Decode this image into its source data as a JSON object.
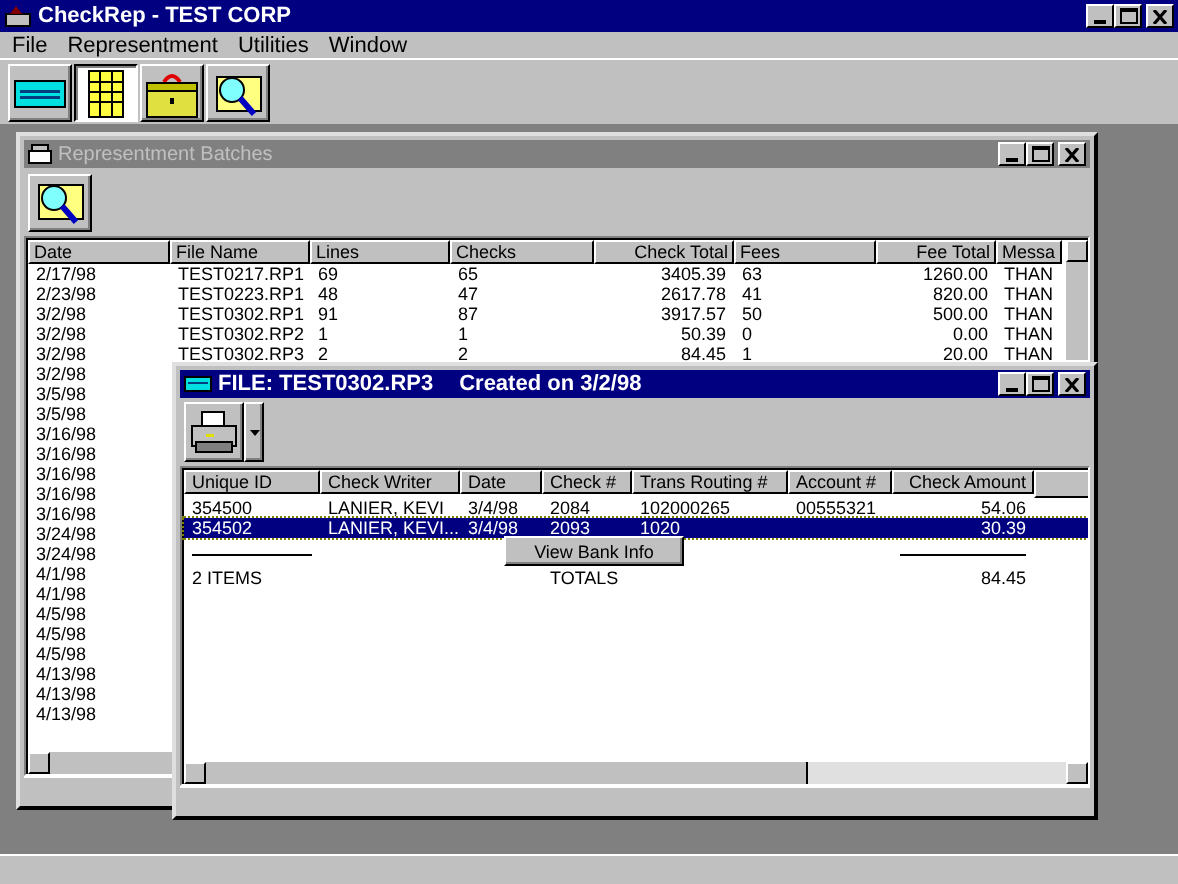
{
  "window": {
    "title": "CheckRep - TEST CORP"
  },
  "menu": [
    "File",
    "Representment",
    "Utilities",
    "Window"
  ],
  "toolbar": [
    {
      "kind": "check",
      "selected": false
    },
    {
      "kind": "ledger",
      "selected": true
    },
    {
      "kind": "cashbox",
      "selected": false
    },
    {
      "kind": "search",
      "selected": false
    }
  ],
  "batches": {
    "title": "Representment Batches",
    "columns": [
      "Date",
      "File Name",
      "Lines",
      "Checks",
      "Check Total",
      "Fees",
      "Fee Total",
      "Messa"
    ],
    "rows": [
      [
        "2/17/98",
        "TEST0217.RP1",
        "69",
        "65",
        "3405.39",
        "63",
        "1260.00",
        "THAN"
      ],
      [
        "2/23/98",
        "TEST0223.RP1",
        "48",
        "47",
        "2617.78",
        "41",
        "820.00",
        "THAN"
      ],
      [
        "3/2/98",
        "TEST0302.RP1",
        "91",
        "87",
        "3917.57",
        "50",
        "500.00",
        "THAN"
      ],
      [
        "3/2/98",
        "TEST0302.RP2",
        "1",
        "1",
        "50.39",
        "0",
        "0.00",
        "THAN"
      ],
      [
        "3/2/98",
        "TEST0302.RP3",
        "2",
        "2",
        "84.45",
        "1",
        "20.00",
        "THAN"
      ],
      [
        "3/2/98"
      ],
      [
        "3/5/98"
      ],
      [
        "3/5/98"
      ],
      [
        "3/16/98"
      ],
      [
        "3/16/98"
      ],
      [
        "3/16/98"
      ],
      [
        "3/16/98"
      ],
      [
        "3/16/98"
      ],
      [
        "3/24/98"
      ],
      [
        "3/24/98"
      ],
      [
        "4/1/98"
      ],
      [
        "4/1/98"
      ],
      [
        "4/5/98"
      ],
      [
        "4/5/98"
      ],
      [
        "4/5/98"
      ],
      [
        "4/13/98"
      ],
      [
        "4/13/98"
      ],
      [
        "4/13/98"
      ]
    ]
  },
  "file_window": {
    "title": "FILE:  TEST0302.RP3",
    "created": "Created on 3/2/98",
    "columns": [
      "Unique ID",
      "Check Writer",
      "Date",
      "Check #",
      "Trans Routing #",
      "Account #",
      "Check Amount"
    ],
    "rows": [
      {
        "cells": [
          "354500",
          "LANIER, KEVI",
          "3/4/98",
          "2084",
          "102000265",
          "00555321",
          "54.06"
        ],
        "selected": false
      },
      {
        "cells": [
          "354502",
          "LANIER, KEVI...",
          "3/4/98",
          "2093",
          "1020",
          "",
          "30.39"
        ],
        "selected": true
      }
    ],
    "summary": {
      "count": "2 ITEMS",
      "label": "TOTALS",
      "total": "84.45"
    }
  },
  "context_menu": {
    "items": [
      "View Bank Info"
    ]
  }
}
